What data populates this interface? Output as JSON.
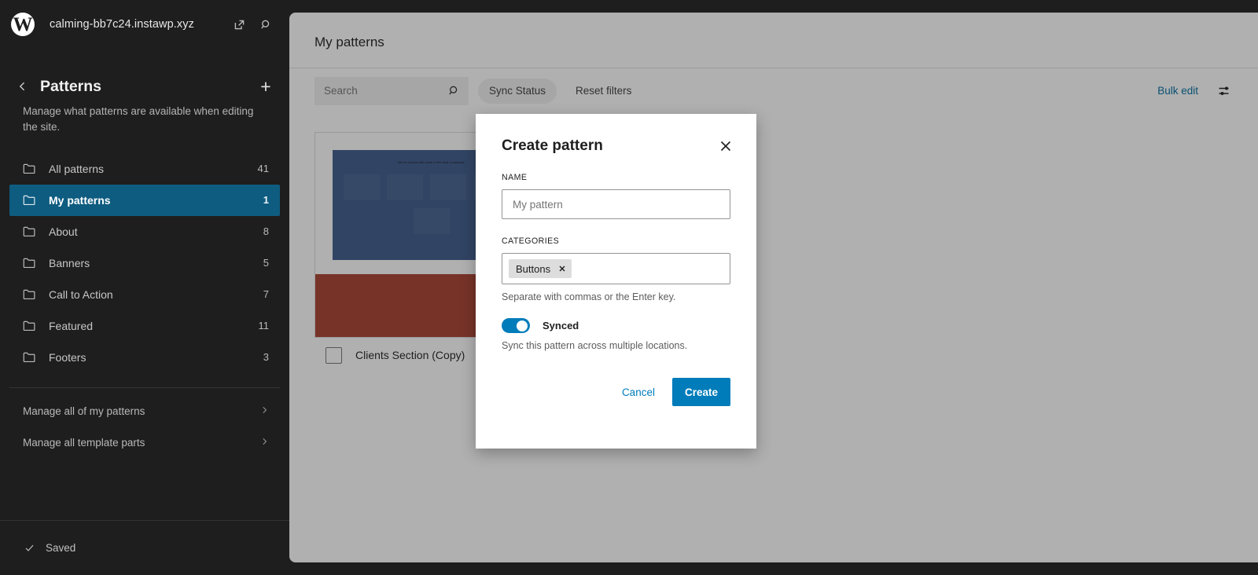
{
  "sidebar": {
    "site_title": "calming-bb7c24.instawp.xyz",
    "logo_glyph": "W",
    "header_icons": [
      "external-link-icon",
      "search-icon"
    ],
    "panel_title": "Patterns",
    "panel_description": "Manage what patterns are available when editing the site.",
    "add_label": "+",
    "nav_items": [
      {
        "label": "All patterns",
        "count": "41",
        "selected": false
      },
      {
        "label": "My patterns",
        "count": "1",
        "selected": true
      },
      {
        "label": "About",
        "count": "8",
        "selected": false
      },
      {
        "label": "Banners",
        "count": "5",
        "selected": false
      },
      {
        "label": "Call to Action",
        "count": "7",
        "selected": false
      },
      {
        "label": "Featured",
        "count": "11",
        "selected": false
      },
      {
        "label": "Footers",
        "count": "3",
        "selected": false
      }
    ],
    "manage_items": [
      {
        "label": "Manage all of my patterns"
      },
      {
        "label": "Manage all template parts"
      }
    ],
    "saved_label": "Saved"
  },
  "main": {
    "title": "My patterns",
    "search_placeholder": "Search",
    "sync_status_label": "Sync Status",
    "reset_filters_label": "Reset filters",
    "bulk_edit_label": "Bulk edit",
    "card": {
      "thumb_heading": "We've worked with some of the best companies",
      "title": "Clients Section (Copy)",
      "checked": false
    }
  },
  "modal": {
    "title": "Create pattern",
    "name_label": "NAME",
    "name_value": "",
    "name_placeholder": "My pattern",
    "categories_label": "CATEGORIES",
    "category_tokens": [
      "Buttons"
    ],
    "categories_help": "Separate with commas or the Enter key.",
    "synced_label": "Synced",
    "synced_on": true,
    "synced_help": "Sync this pattern across multiple locations.",
    "cancel_label": "Cancel",
    "create_label": "Create"
  },
  "colors": {
    "accent": "#007cba",
    "sidebar_bg": "#1e1e1e",
    "selected_nav": "#0e5c80",
    "thumb_blue": "#3d5a8a",
    "thumb_red": "#a8402f"
  }
}
